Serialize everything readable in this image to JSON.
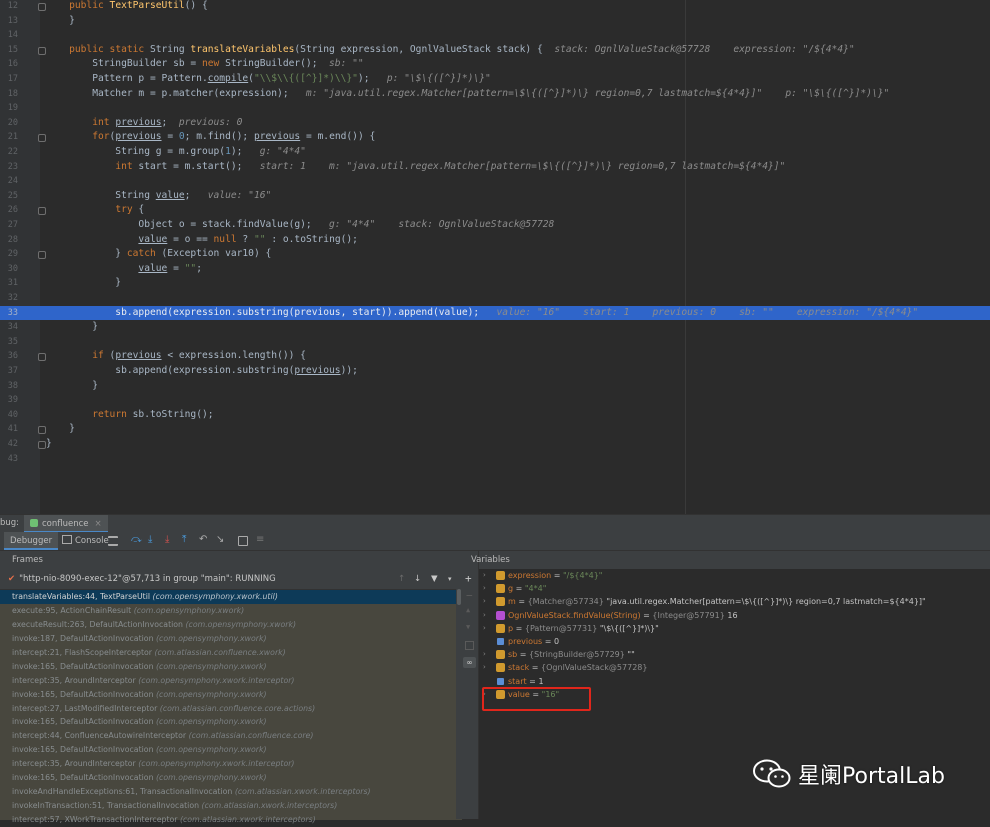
{
  "editor": {
    "lines": [
      {
        "num": "12",
        "segments": [
          {
            "t": "    "
          },
          {
            "t": "public ",
            "c": "kw"
          },
          {
            "t": "TextParseUtil",
            "c": "fn"
          },
          {
            "t": "() {"
          }
        ]
      },
      {
        "num": "13",
        "segments": [
          {
            "t": "    }"
          }
        ]
      },
      {
        "num": "14",
        "segments": []
      },
      {
        "num": "15",
        "segments": [
          {
            "t": "    "
          },
          {
            "t": "public static ",
            "c": "kw"
          },
          {
            "t": "String "
          },
          {
            "t": "translateVariables",
            "c": "fn"
          },
          {
            "t": "(String expression, OgnlValueStack stack) {  "
          },
          {
            "t": "stack: OgnlValueStack@57728    expression: \"/${4*4}\"",
            "c": "ann"
          }
        ]
      },
      {
        "num": "16",
        "segments": [
          {
            "t": "        StringBuilder sb = "
          },
          {
            "t": "new ",
            "c": "kw"
          },
          {
            "t": "StringBuilder();  "
          },
          {
            "t": "sb: \"\"",
            "c": "ann"
          }
        ]
      },
      {
        "num": "17",
        "segments": [
          {
            "t": "        Pattern p = Pattern."
          },
          {
            "t": "compile",
            "c": "und"
          },
          {
            "t": "("
          },
          {
            "t": "\"\\\\$\\\\{([^}]*)\\\\}\"",
            "c": "str"
          },
          {
            "t": ");   "
          },
          {
            "t": "p: \"\\$\\{([^}]*)\\}\"",
            "c": "ann"
          }
        ]
      },
      {
        "num": "18",
        "segments": [
          {
            "t": "        Matcher m = p.matcher(expression);   "
          },
          {
            "t": "m: \"java.util.regex.Matcher[pattern=\\$\\{([^}]*)\\} region=0,7 lastmatch=${4*4}]\"    p: \"\\$\\{([^}]*)\\}\"",
            "c": "ann"
          }
        ]
      },
      {
        "num": "19",
        "segments": []
      },
      {
        "num": "20",
        "segments": [
          {
            "t": "        "
          },
          {
            "t": "int ",
            "c": "kw"
          },
          {
            "t": "previous",
            "c": "und"
          },
          {
            "t": ";  "
          },
          {
            "t": "previous: 0",
            "c": "ann"
          }
        ]
      },
      {
        "num": "21",
        "segments": [
          {
            "t": "        "
          },
          {
            "t": "for",
            "c": "kw"
          },
          {
            "t": "("
          },
          {
            "t": "previous",
            "c": "und"
          },
          {
            "t": " = "
          },
          {
            "t": "0",
            "c": "num"
          },
          {
            "t": "; m.find(); "
          },
          {
            "t": "previous",
            "c": "und"
          },
          {
            "t": " = m.end()) {"
          }
        ]
      },
      {
        "num": "22",
        "segments": [
          {
            "t": "            String g = m.group("
          },
          {
            "t": "1",
            "c": "num"
          },
          {
            "t": ");   "
          },
          {
            "t": "g: \"4*4\"",
            "c": "ann"
          }
        ]
      },
      {
        "num": "23",
        "segments": [
          {
            "t": "            "
          },
          {
            "t": "int ",
            "c": "kw"
          },
          {
            "t": "start = m.start();   "
          },
          {
            "t": "start: 1    m: \"java.util.regex.Matcher[pattern=\\$\\{([^}]*)\\} region=0,7 lastmatch=${4*4}]\"",
            "c": "ann"
          }
        ]
      },
      {
        "num": "24",
        "segments": []
      },
      {
        "num": "25",
        "segments": [
          {
            "t": "            String "
          },
          {
            "t": "value",
            "c": "und"
          },
          {
            "t": ";   "
          },
          {
            "t": "value: \"16\"",
            "c": "ann"
          }
        ]
      },
      {
        "num": "26",
        "segments": [
          {
            "t": "            "
          },
          {
            "t": "try ",
            "c": "kw"
          },
          {
            "t": "{"
          }
        ]
      },
      {
        "num": "27",
        "segments": [
          {
            "t": "                Object o = stack.findValue(g);   "
          },
          {
            "t": "g: \"4*4\"    stack: OgnlValueStack@57728",
            "c": "ann"
          }
        ]
      },
      {
        "num": "28",
        "segments": [
          {
            "t": "                "
          },
          {
            "t": "value",
            "c": "und"
          },
          {
            "t": " = o == "
          },
          {
            "t": "null ",
            "c": "kw"
          },
          {
            "t": "? "
          },
          {
            "t": "\"\" ",
            "c": "str"
          },
          {
            "t": ": o.toString();"
          }
        ]
      },
      {
        "num": "29",
        "segments": [
          {
            "t": "            } "
          },
          {
            "t": "catch ",
            "c": "kw"
          },
          {
            "t": "(Exception var10) {"
          }
        ]
      },
      {
        "num": "30",
        "segments": [
          {
            "t": "                "
          },
          {
            "t": "value",
            "c": "und"
          },
          {
            "t": " = "
          },
          {
            "t": "\"\"",
            "c": "str"
          },
          {
            "t": ";"
          }
        ]
      },
      {
        "num": "31",
        "segments": [
          {
            "t": "            }"
          }
        ]
      },
      {
        "num": "32",
        "segments": []
      },
      {
        "num": "33",
        "highlight": true,
        "segments": [
          {
            "t": "            sb.append(expression.substring(previous, start)).append(value);   "
          },
          {
            "t": "value: \"16\"    start: 1    previous: 0    sb: \"\"    expression: \"/${4*4}\"",
            "c": "ann"
          }
        ]
      },
      {
        "num": "34",
        "segments": [
          {
            "t": "        }"
          }
        ]
      },
      {
        "num": "35",
        "segments": []
      },
      {
        "num": "36",
        "segments": [
          {
            "t": "        "
          },
          {
            "t": "if ",
            "c": "kw"
          },
          {
            "t": "("
          },
          {
            "t": "previous",
            "c": "und"
          },
          {
            "t": " < expression.length()) {"
          }
        ]
      },
      {
        "num": "37",
        "segments": [
          {
            "t": "            sb.append(expression.substring("
          },
          {
            "t": "previous",
            "c": "und"
          },
          {
            "t": "));"
          }
        ]
      },
      {
        "num": "38",
        "segments": [
          {
            "t": "        }"
          }
        ]
      },
      {
        "num": "39",
        "segments": []
      },
      {
        "num": "40",
        "segments": [
          {
            "t": "        "
          },
          {
            "t": "return ",
            "c": "kw"
          },
          {
            "t": "sb.toString();"
          }
        ]
      },
      {
        "num": "41",
        "segments": [
          {
            "t": "    }"
          }
        ]
      },
      {
        "num": "42",
        "segments": [
          {
            "t": "}"
          }
        ]
      },
      {
        "num": "43",
        "segments": []
      }
    ]
  },
  "debug": {
    "title_prefix": "bug:",
    "session_tab": "confluence",
    "tab_debugger": "Debugger",
    "tab_console": "Console"
  },
  "frames": {
    "header": "Frames",
    "thread": "\"http-nio-8090-exec-12\"@57,713 in group \"main\": RUNNING",
    "items": [
      {
        "m": "translateVariables:44, TextParseUtil",
        "p": "(com.opensymphony.xwork.util)",
        "sel": true
      },
      {
        "m": "execute:95, ActionChainResult",
        "p": "(com.opensymphony.xwork)"
      },
      {
        "m": "executeResult:263, DefaultActionInvocation",
        "p": "(com.opensymphony.xwork)"
      },
      {
        "m": "invoke:187, DefaultActionInvocation",
        "p": "(com.opensymphony.xwork)"
      },
      {
        "m": "intercept:21, FlashScopeInterceptor",
        "p": "(com.atlassian.confluence.xwork)"
      },
      {
        "m": "invoke:165, DefaultActionInvocation",
        "p": "(com.opensymphony.xwork)"
      },
      {
        "m": "intercept:35, AroundInterceptor",
        "p": "(com.opensymphony.xwork.interceptor)"
      },
      {
        "m": "invoke:165, DefaultActionInvocation",
        "p": "(com.opensymphony.xwork)"
      },
      {
        "m": "intercept:27, LastModifiedInterceptor",
        "p": "(com.atlassian.confluence.core.actions)"
      },
      {
        "m": "invoke:165, DefaultActionInvocation",
        "p": "(com.opensymphony.xwork)"
      },
      {
        "m": "intercept:44, ConfluenceAutowireInterceptor",
        "p": "(com.atlassian.confluence.core)"
      },
      {
        "m": "invoke:165, DefaultActionInvocation",
        "p": "(com.opensymphony.xwork)"
      },
      {
        "m": "intercept:35, AroundInterceptor",
        "p": "(com.opensymphony.xwork.interceptor)"
      },
      {
        "m": "invoke:165, DefaultActionInvocation",
        "p": "(com.opensymphony.xwork)"
      },
      {
        "m": "invokeAndHandleExceptions:61, TransactionalInvocation",
        "p": "(com.atlassian.xwork.interceptors)"
      },
      {
        "m": "invokeInTransaction:51, TransactionalInvocation",
        "p": "(com.atlassian.xwork.interceptors)"
      },
      {
        "m": "intercept:57, XWorkTransactionInterceptor",
        "p": "(com.atlassian.xwork.interceptors)"
      }
    ]
  },
  "variables": {
    "header": "Variables",
    "items": [
      {
        "arrow": "›",
        "icon": "#d19a2e",
        "name": "expression",
        "rest": [
          {
            "t": " = "
          },
          {
            "t": "\"/${4*4}\"",
            "c": "vs"
          }
        ]
      },
      {
        "arrow": "›",
        "icon": "#d19a2e",
        "name": "g",
        "rest": [
          {
            "t": " = "
          },
          {
            "t": "\"4*4\"",
            "c": "vs"
          }
        ]
      },
      {
        "arrow": "›",
        "icon": "#d19a2e",
        "name": "m",
        "rest": [
          {
            "t": " = "
          },
          {
            "t": "{Matcher@57734} ",
            "c": "vt"
          },
          {
            "t": "\"java.util.regex.Matcher[pattern=\\$\\{([^}]*)\\} region=0,7 lastmatch=${4*4}]\""
          }
        ]
      },
      {
        "arrow": "›",
        "icon": "#b54fd0",
        "name": "OgnlValueStack.findValue(String)",
        "rest": [
          {
            "t": " = "
          },
          {
            "t": "{Integer@57791} ",
            "c": "vt"
          },
          {
            "t": "16"
          }
        ]
      },
      {
        "arrow": "›",
        "icon": "#d19a2e",
        "name": "p",
        "rest": [
          {
            "t": " = "
          },
          {
            "t": "{Pattern@57731} ",
            "c": "vt"
          },
          {
            "t": "\"\\$\\{([^}]*)\\}\""
          }
        ]
      },
      {
        "arrow": "",
        "icon": "#5b8ed6",
        "name": "previous",
        "plain": true,
        "rest": [
          {
            "t": " = "
          },
          {
            "t": "0"
          }
        ]
      },
      {
        "arrow": "›",
        "icon": "#d19a2e",
        "name": "sb",
        "rest": [
          {
            "t": " = "
          },
          {
            "t": "{StringBuilder@57729} ",
            "c": "vt"
          },
          {
            "t": "\"\""
          }
        ]
      },
      {
        "arrow": "›",
        "icon": "#d19a2e",
        "name": "stack",
        "rest": [
          {
            "t": " = "
          },
          {
            "t": "{OgnlValueStack@57728}",
            "c": "vt"
          }
        ]
      },
      {
        "arrow": "",
        "icon": "#5b8ed6",
        "name": "start",
        "plain": true,
        "rest": [
          {
            "t": " = "
          },
          {
            "t": "1"
          }
        ]
      },
      {
        "arrow": "›",
        "icon": "#d19a2e",
        "name": "value",
        "rest": [
          {
            "t": " = "
          },
          {
            "t": "\"16\"",
            "c": "vs"
          }
        ]
      }
    ]
  },
  "watermark": {
    "text": "星阑PortalLab"
  }
}
